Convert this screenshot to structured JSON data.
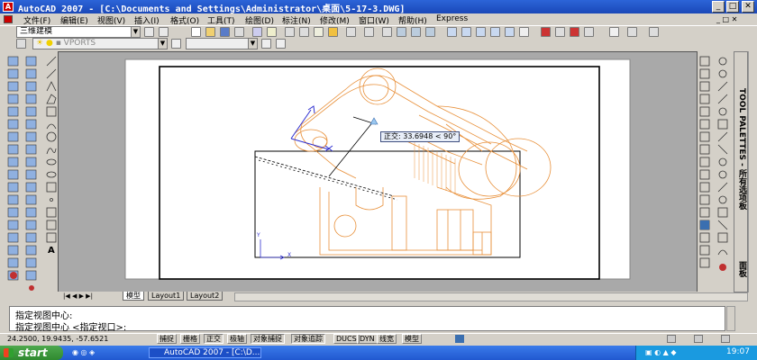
{
  "window": {
    "title": "AutoCAD 2007 - [C:\\Documents and Settings\\Administrator\\桌面\\5-17-3.DWG]",
    "min_label": "_",
    "max_label": "□",
    "close_label": "✕"
  },
  "menu": [
    "文件(F)",
    "编辑(E)",
    "视图(V)",
    "插入(I)",
    "格式(O)",
    "工具(T)",
    "绘图(D)",
    "标注(N)",
    "修改(M)",
    "窗口(W)",
    "帮助(H)",
    "Express"
  ],
  "toolbar": {
    "workspace": "三维建模",
    "layer_name": "VPORTS"
  },
  "drawing": {
    "tooltip": "正交: 33.6948 < 90°",
    "axis_x": "X",
    "axis_y": "Y"
  },
  "tabs": [
    "模型",
    "Layout1",
    "Layout2"
  ],
  "command": {
    "line1": "指定视图中心:",
    "line2": "指定视图中心 <指定视口>:"
  },
  "status": {
    "coords": "24.2500, 19.9435, -57.6521",
    "buttons": [
      "捕捉",
      "栅格",
      "正交",
      "极轴",
      "对象捕捉",
      "对象追踪",
      "DUCS",
      "DYN",
      "线宽",
      "模型"
    ]
  },
  "palette": {
    "title": "TOOL PALETTES - 所有选项板",
    "tab": "面板"
  },
  "taskbar": {
    "start": "start",
    "task": "AutoCAD 2007 - [C:\\D...",
    "time": "19:07"
  }
}
